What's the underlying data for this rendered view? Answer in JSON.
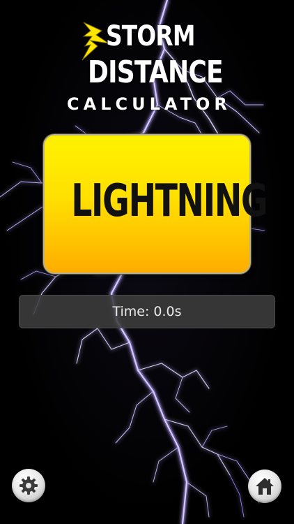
{
  "logo": {
    "line1": "STORM",
    "line2": "DISTANCE",
    "line3": "CALCULATOR",
    "bolt_icon": "lightning-bolt-icon",
    "bolt_color": "#ffe600"
  },
  "lightning_button": {
    "label": "LIGHTNING",
    "color_top": "#fff200",
    "color_bottom": "#ffac00"
  },
  "time_display": {
    "text": "Time: 0.0s"
  },
  "bottom_bar": {
    "settings_icon": "gear-icon",
    "home_icon": "home-icon"
  }
}
